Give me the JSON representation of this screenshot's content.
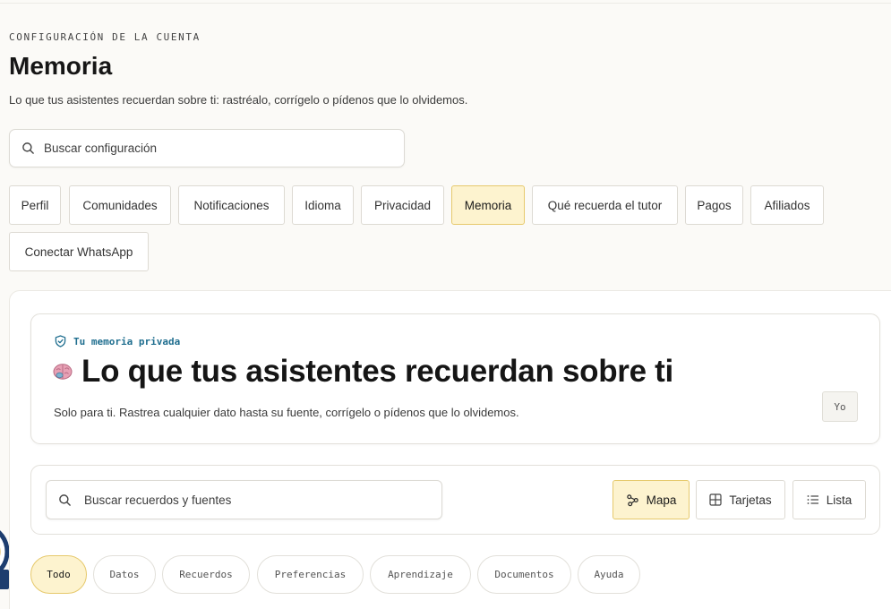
{
  "header": {
    "eyebrow": "CONFIGURACIÓN DE LA CUENTA",
    "title": "Memoria",
    "subtitle": "Lo que tus asistentes recuerdan sobre ti: rastréalo, corrígelo o pídenos que lo olvidemos."
  },
  "settings_search": {
    "placeholder": "Buscar configuración",
    "icon": "search-icon"
  },
  "tabs": [
    {
      "label": "Perfil"
    },
    {
      "label": "Comunidades"
    },
    {
      "label": "Notificaciones"
    },
    {
      "label": "Idioma"
    },
    {
      "label": "Privacidad"
    },
    {
      "label": "Memoria",
      "active": true
    },
    {
      "label": "Qué recuerda el tutor"
    },
    {
      "label": "Pagos"
    },
    {
      "label": "Afiliados"
    },
    {
      "label": "Conectar WhatsApp"
    }
  ],
  "hero": {
    "kicker": "Tu memoria privada",
    "kicker_icon": "shield-check-icon",
    "title_icon": "brain-icon",
    "title": "Lo que tus asistentes recuerdan sobre ti",
    "description": "Solo para ti. Rastrea cualquier dato hasta su fuente, corrígelo o pídenos que lo olvidemos.",
    "badge": "Yo"
  },
  "memory_toolbar": {
    "search_placeholder": "Buscar recuerdos y fuentes",
    "views": [
      {
        "label": "Mapa",
        "icon": "graph-icon",
        "active": true
      },
      {
        "label": "Tarjetas",
        "icon": "grid-icon"
      },
      {
        "label": "Lista",
        "icon": "list-icon"
      }
    ]
  },
  "filters": [
    {
      "label": "Todo",
      "active": true
    },
    {
      "label": "Datos"
    },
    {
      "label": "Recuerdos"
    },
    {
      "label": "Preferencias"
    },
    {
      "label": "Aprendizaje"
    },
    {
      "label": "Documentos"
    },
    {
      "label": "Ayuda"
    }
  ],
  "colors": {
    "accent_fill": "#fdf3cf",
    "accent_border": "#e6c96c",
    "kicker": "#1f6e8f",
    "background": "#fbfaf7"
  }
}
